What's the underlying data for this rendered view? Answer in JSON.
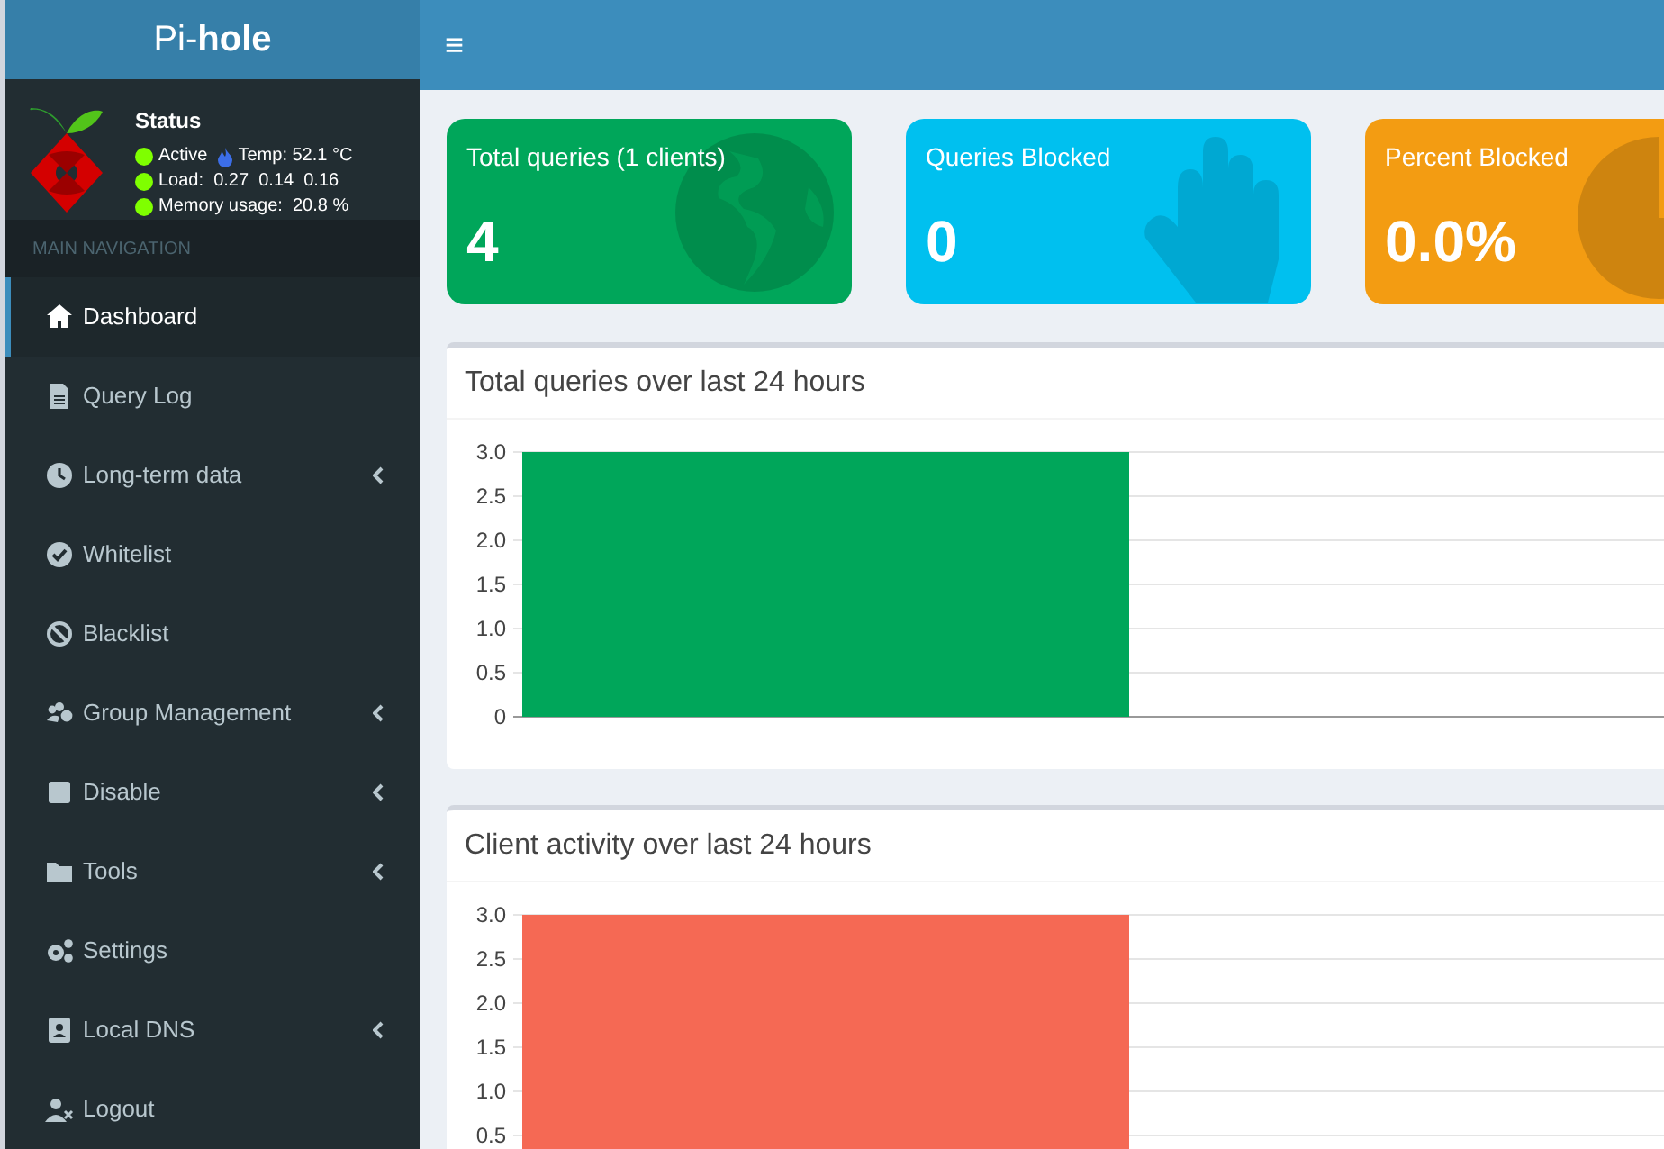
{
  "header": {
    "logo_light": "Pi-",
    "logo_bold": "hole",
    "menu_toggle": "≡"
  },
  "status": {
    "title": "Status",
    "lines": [
      {
        "kind": "active",
        "text": "Active",
        "color": "#7fff00",
        "extra": "Temp: 52.1 °C"
      },
      {
        "kind": "plain",
        "text": "Load:  0.27  0.14  0.16",
        "color": "#7fff00"
      },
      {
        "kind": "plain",
        "text": "Memory usage:  20.8 %",
        "color": "#7fff00"
      }
    ]
  },
  "nav_header": "MAIN NAVIGATION",
  "nav": [
    {
      "label": "Dashboard",
      "kind": "home",
      "selected": true,
      "expandable": false
    },
    {
      "label": "Query Log",
      "kind": "file",
      "selected": false,
      "expandable": false
    },
    {
      "label": "Long-term data",
      "kind": "clock",
      "selected": false,
      "expandable": true
    },
    {
      "label": "Whitelist",
      "kind": "check",
      "selected": false,
      "expandable": false
    },
    {
      "label": "Blacklist",
      "kind": "ban",
      "selected": false,
      "expandable": false
    },
    {
      "label": "Group Management",
      "kind": "users",
      "selected": false,
      "expandable": true
    },
    {
      "label": "Disable",
      "kind": "square",
      "selected": false,
      "expandable": true
    },
    {
      "label": "Tools",
      "kind": "folder",
      "selected": false,
      "expandable": true
    },
    {
      "label": "Settings",
      "kind": "gears",
      "selected": false,
      "expandable": false
    },
    {
      "label": "Local DNS",
      "kind": "contact",
      "selected": false,
      "expandable": true
    },
    {
      "label": "Logout",
      "kind": "user-x",
      "selected": false,
      "expandable": false
    }
  ],
  "stats": [
    {
      "title": "Total queries (1 clients)",
      "value": "4",
      "color": "#00a65a",
      "kind": "globe"
    },
    {
      "title": "Queries Blocked",
      "value": "0",
      "color": "#00c0ef",
      "kind": "hand"
    },
    {
      "title": "Percent Blocked",
      "value": "0.0%",
      "color": "#f39c12",
      "kind": "pie"
    }
  ],
  "charts": [
    {
      "title": "Total queries over last 24 hours",
      "chart_data": {
        "type": "bar",
        "grid": true,
        "series": [
          {
            "color": "#00a65a",
            "values": [
              3,
              null
            ]
          }
        ],
        "ylim": [
          0,
          3
        ],
        "yticks": [
          0,
          {
            "value": 0.5,
            "label": "0.5"
          },
          {
            "value": 1,
            "label": "1.0"
          },
          {
            "value": 1.5,
            "label": "1.5"
          },
          {
            "value": 2,
            "label": "2.0"
          },
          {
            "value": 2.5,
            "label": "2.5"
          },
          {
            "value": 3,
            "label": "3.0"
          }
        ]
      }
    },
    {
      "title": "Client activity over last 24 hours",
      "chart_data": {
        "type": "bar",
        "grid": true,
        "series": [
          {
            "color": "#f56954",
            "values": [
              3,
              null
            ]
          }
        ],
        "ylim": [
          0,
          3
        ],
        "yticks": [
          {
            "value": 0.5,
            "label": "0.5"
          },
          {
            "value": 1,
            "label": "1.0"
          },
          {
            "value": 1.5,
            "label": "1.5"
          },
          {
            "value": 2,
            "label": "2.0"
          },
          {
            "value": 2.5,
            "label": "2.5"
          },
          {
            "value": 3,
            "label": "3.0"
          }
        ]
      }
    }
  ]
}
